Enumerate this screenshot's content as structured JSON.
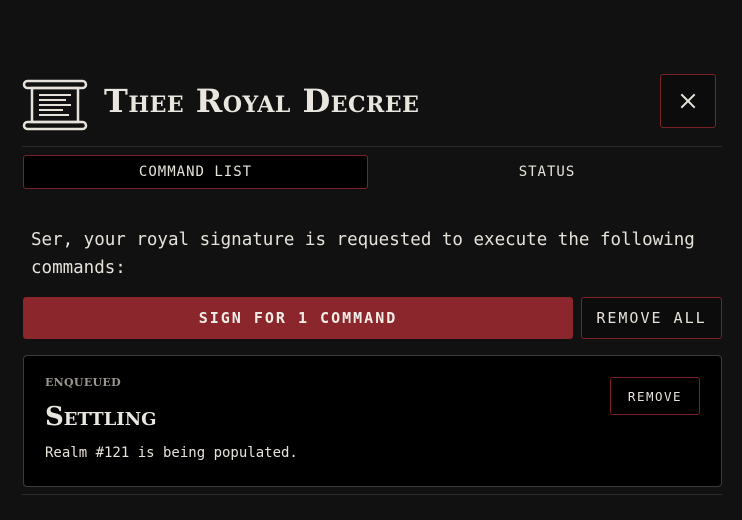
{
  "header": {
    "title": "Thee Royal Decree",
    "icon": "scroll-icon",
    "close_icon": "close-icon"
  },
  "tabs": [
    {
      "label": "COMMAND LIST",
      "active": true
    },
    {
      "label": "STATUS",
      "active": false
    }
  ],
  "intro_text": "Ser, your royal signature is requested to execute the following commands:",
  "actions": {
    "sign_label": "SIGN FOR 1 COMMAND",
    "remove_all_label": "REMOVE ALL"
  },
  "commands": [
    {
      "status": "ENQUEUED",
      "title": "Settling",
      "description": "Realm #121 is being populated.",
      "remove_label": "REMOVE"
    }
  ],
  "colors": {
    "background": "#111111",
    "accent": "#8a262c",
    "border_accent": "#7a2226",
    "text": "#e6e2da"
  }
}
